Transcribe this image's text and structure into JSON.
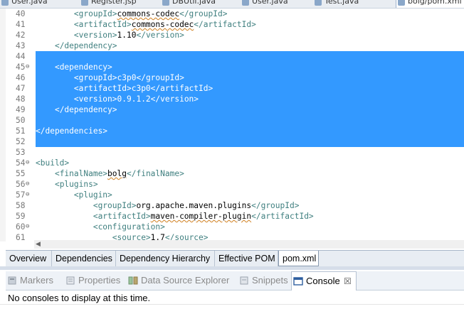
{
  "top_tabs": [
    {
      "label": "User.java",
      "icon": "java-file-icon",
      "active": false
    },
    {
      "label": "Register.jsp",
      "icon": "jsp-file-icon",
      "active": false
    },
    {
      "label": "DBUtil.java",
      "icon": "java-file-icon",
      "active": false
    },
    {
      "label": "User.java",
      "icon": "java-file-icon",
      "active": false
    },
    {
      "label": "Test.java",
      "icon": "java-file-icon",
      "active": false
    },
    {
      "label": "bolg/pom.xml",
      "icon": "maven-pom-icon",
      "active": true
    }
  ],
  "editor": {
    "lines": [
      {
        "n": "40",
        "fold": "",
        "sel": false,
        "indent": "        ",
        "parts": [
          [
            "t",
            "<groupId>"
          ],
          [
            "s",
            "commons-codec"
          ],
          [
            "t",
            "</groupId>"
          ]
        ]
      },
      {
        "n": "41",
        "fold": "",
        "sel": false,
        "indent": "        ",
        "parts": [
          [
            "t",
            "<artifactId>"
          ],
          [
            "s",
            "commons-codec"
          ],
          [
            "t",
            "</artifactId>"
          ]
        ]
      },
      {
        "n": "42",
        "fold": "",
        "sel": false,
        "indent": "        ",
        "parts": [
          [
            "t",
            "<version>"
          ],
          [
            "x",
            "1.10"
          ],
          [
            "t",
            "</version>"
          ]
        ]
      },
      {
        "n": "43",
        "fold": "",
        "sel": false,
        "indent": "    ",
        "parts": [
          [
            "t",
            "</dependency>"
          ]
        ]
      },
      {
        "n": "44",
        "fold": "",
        "sel": true,
        "indent": "",
        "parts": []
      },
      {
        "n": "45",
        "fold": "⊖",
        "sel": true,
        "indent": "    ",
        "parts": [
          [
            "t",
            "<dependency>"
          ]
        ]
      },
      {
        "n": "46",
        "fold": "",
        "sel": true,
        "indent": "        ",
        "parts": [
          [
            "t",
            "<groupId>"
          ],
          [
            "x",
            "c3p0"
          ],
          [
            "t",
            "</groupId>"
          ]
        ]
      },
      {
        "n": "47",
        "fold": "",
        "sel": true,
        "indent": "        ",
        "parts": [
          [
            "t",
            "<artifactId>"
          ],
          [
            "x",
            "c3p0"
          ],
          [
            "t",
            "</artifactId>"
          ]
        ]
      },
      {
        "n": "48",
        "fold": "",
        "sel": true,
        "indent": "        ",
        "parts": [
          [
            "t",
            "<version>"
          ],
          [
            "x",
            "0.9.1.2"
          ],
          [
            "t",
            "</version>"
          ]
        ]
      },
      {
        "n": "49",
        "fold": "",
        "sel": true,
        "indent": "    ",
        "parts": [
          [
            "t",
            "</dependency>"
          ]
        ]
      },
      {
        "n": "50",
        "fold": "",
        "sel": true,
        "indent": "",
        "parts": []
      },
      {
        "n": "51",
        "fold": "",
        "sel": true,
        "indent": "",
        "parts": [
          [
            "t",
            "</dependencies>"
          ]
        ]
      },
      {
        "n": "52",
        "fold": "",
        "sel": true,
        "indent": "",
        "parts": []
      },
      {
        "n": "53",
        "fold": "",
        "sel": false,
        "indent": "",
        "parts": []
      },
      {
        "n": "54",
        "fold": "⊖",
        "sel": false,
        "indent": "",
        "parts": [
          [
            "t",
            "<build>"
          ]
        ]
      },
      {
        "n": "55",
        "fold": "",
        "sel": false,
        "indent": "    ",
        "parts": [
          [
            "t",
            "<finalName>"
          ],
          [
            "s",
            "bolg"
          ],
          [
            "t",
            "</finalName>"
          ]
        ]
      },
      {
        "n": "56",
        "fold": "⊖",
        "sel": false,
        "indent": "    ",
        "parts": [
          [
            "t",
            "<plugins>"
          ]
        ]
      },
      {
        "n": "57",
        "fold": "⊖",
        "sel": false,
        "indent": "        ",
        "parts": [
          [
            "t",
            "<plugin>"
          ]
        ]
      },
      {
        "n": "58",
        "fold": "",
        "sel": false,
        "indent": "            ",
        "parts": [
          [
            "t",
            "<groupId>"
          ],
          [
            "x",
            "org.apache.maven.plugins"
          ],
          [
            "t",
            "</groupId>"
          ]
        ]
      },
      {
        "n": "59",
        "fold": "",
        "sel": false,
        "indent": "            ",
        "parts": [
          [
            "t",
            "<artifactId>"
          ],
          [
            "s",
            "maven-compiler-plugin"
          ],
          [
            "t",
            "</artifactId>"
          ]
        ]
      },
      {
        "n": "60",
        "fold": "⊖",
        "sel": false,
        "indent": "            ",
        "parts": [
          [
            "t",
            "<configuration>"
          ]
        ]
      },
      {
        "n": "61",
        "fold": "",
        "sel": false,
        "indent": "                ",
        "parts": [
          [
            "t",
            "<source>"
          ],
          [
            "x",
            "1.7"
          ],
          [
            "t",
            "</source>"
          ]
        ]
      }
    ]
  },
  "pom_tabs": [
    {
      "label": "Overview",
      "active": false
    },
    {
      "label": "Dependencies",
      "active": false
    },
    {
      "label": "Dependency Hierarchy",
      "active": false
    },
    {
      "label": "Effective POM",
      "active": false
    },
    {
      "label": "pom.xml",
      "active": true
    }
  ],
  "view_tabs": [
    {
      "label": "Markers",
      "icon": "markers-icon",
      "active": false
    },
    {
      "label": "Properties",
      "icon": "properties-icon",
      "active": false
    },
    {
      "label": "Data Source Explorer",
      "icon": "data-source-explorer-icon",
      "active": false
    },
    {
      "label": "Snippets",
      "icon": "snippets-icon",
      "active": false
    },
    {
      "label": "Console",
      "icon": "console-icon",
      "active": true,
      "close": "☒"
    }
  ],
  "console": {
    "message": "No consoles to display at this time."
  },
  "colors": {
    "selection": "#3399ff",
    "tag": "#3f7f7f",
    "line_number": "#787878"
  }
}
